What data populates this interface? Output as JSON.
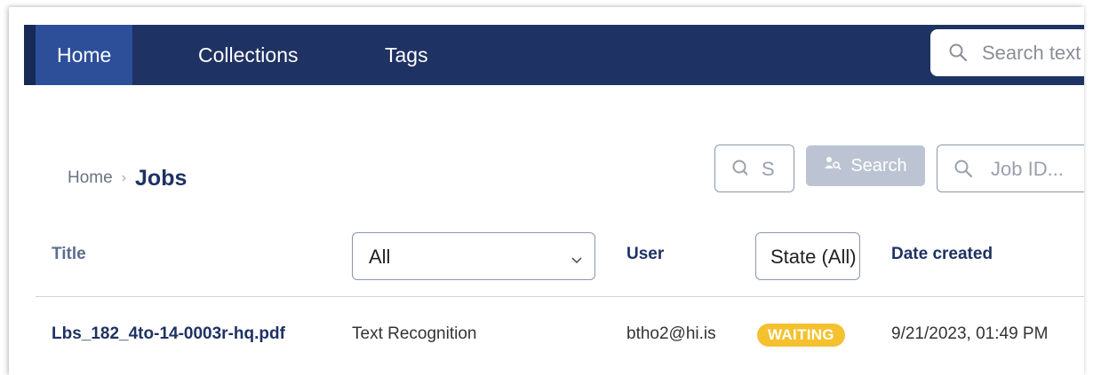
{
  "navbar": {
    "items": [
      {
        "label": "Home",
        "active": true
      },
      {
        "label": "Collections",
        "active": false
      },
      {
        "label": "Tags",
        "active": false
      }
    ],
    "search_placeholder": "Search text"
  },
  "breadcrumb": {
    "home": "Home",
    "current": "Jobs"
  },
  "filters": {
    "title_search_placeholder": "S",
    "search_button_label": "Search",
    "job_id_placeholder": "Job ID..."
  },
  "table": {
    "headers": {
      "title": "Title",
      "type_select_value": "All",
      "user": "User",
      "state_filter": "State (All)",
      "date_created": "Date created"
    },
    "rows": [
      {
        "title": "Lbs_182_4to-14-0003r-hq.pdf",
        "type": "Text Recognition",
        "user": "btho2@hi.is",
        "state": "WAITING",
        "date": "9/21/2023, 01:49 PM"
      }
    ]
  },
  "colors": {
    "navbar": "#1e3263",
    "nav_active": "#2d4f9a",
    "waiting_badge": "#f4c12f",
    "search_button": "#bcc4d3"
  }
}
